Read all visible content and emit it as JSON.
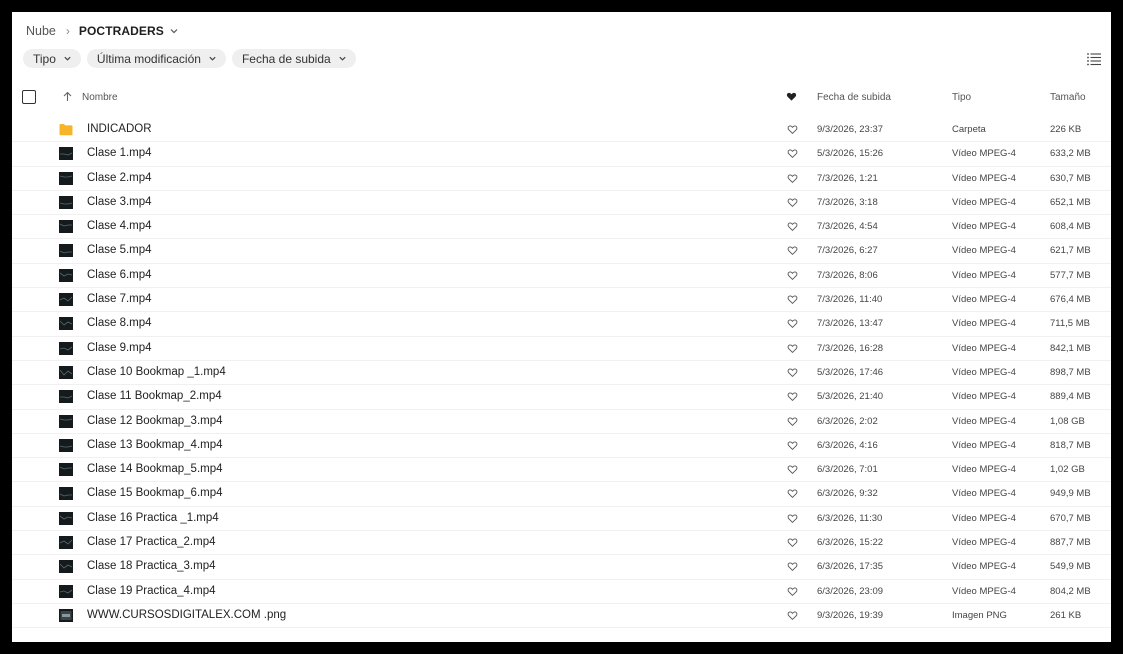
{
  "breadcrumb": {
    "root": "Nube",
    "current": "POCTRADERS"
  },
  "filters": [
    {
      "label": "Tipo"
    },
    {
      "label": "Última modificación"
    },
    {
      "label": "Fecha de subida"
    }
  ],
  "table": {
    "headers": {
      "name": "Nombre",
      "date": "Fecha de subida",
      "type": "Tipo",
      "size": "Tamaño"
    },
    "rows": [
      {
        "name": "INDICADOR",
        "date": "9/3/2026, 23:37",
        "type": "Carpeta",
        "size": "226 KB",
        "icon": "folder-icon"
      },
      {
        "name": "Clase 1.mp4",
        "date": "5/3/2026, 15:26",
        "type": "Vídeo MPEG-4",
        "size": "633,2 MB",
        "icon": "video-thumbnail-icon"
      },
      {
        "name": "Clase 2.mp4",
        "date": "7/3/2026, 1:21",
        "type": "Vídeo MPEG-4",
        "size": "630,7 MB",
        "icon": "video-thumbnail-icon"
      },
      {
        "name": "Clase 3.mp4",
        "date": "7/3/2026, 3:18",
        "type": "Vídeo MPEG-4",
        "size": "652,1 MB",
        "icon": "video-thumbnail-icon"
      },
      {
        "name": "Clase 4.mp4",
        "date": "7/3/2026, 4:54",
        "type": "Vídeo MPEG-4",
        "size": "608,4 MB",
        "icon": "video-thumbnail-icon"
      },
      {
        "name": "Clase 5.mp4",
        "date": "7/3/2026, 6:27",
        "type": "Vídeo MPEG-4",
        "size": "621,7 MB",
        "icon": "video-thumbnail-icon"
      },
      {
        "name": "Clase 6.mp4",
        "date": "7/3/2026, 8:06",
        "type": "Vídeo MPEG-4",
        "size": "577,7 MB",
        "icon": "video-thumbnail-icon"
      },
      {
        "name": "Clase 7.mp4",
        "date": "7/3/2026, 11:40",
        "type": "Vídeo MPEG-4",
        "size": "676,4 MB",
        "icon": "video-thumbnail-icon"
      },
      {
        "name": "Clase 8.mp4",
        "date": "7/3/2026, 13:47",
        "type": "Vídeo MPEG-4",
        "size": "711,5 MB",
        "icon": "video-thumbnail-icon"
      },
      {
        "name": "Clase 9.mp4",
        "date": "7/3/2026, 16:28",
        "type": "Vídeo MPEG-4",
        "size": "842,1 MB",
        "icon": "video-thumbnail-icon"
      },
      {
        "name": "Clase 10 Bookmap _1.mp4",
        "date": "5/3/2026, 17:46",
        "type": "Vídeo MPEG-4",
        "size": "898,7 MB",
        "icon": "video-thumbnail-icon"
      },
      {
        "name": "Clase 11 Bookmap_2.mp4",
        "date": "5/3/2026, 21:40",
        "type": "Vídeo MPEG-4",
        "size": "889,4 MB",
        "icon": "video-thumbnail-icon"
      },
      {
        "name": "Clase 12 Bookmap_3.mp4",
        "date": "6/3/2026, 2:02",
        "type": "Vídeo MPEG-4",
        "size": "1,08 GB",
        "icon": "video-thumbnail-icon"
      },
      {
        "name": "Clase 13 Bookmap_4.mp4",
        "date": "6/3/2026, 4:16",
        "type": "Vídeo MPEG-4",
        "size": "818,7 MB",
        "icon": "video-thumbnail-icon"
      },
      {
        "name": "Clase 14 Bookmap_5.mp4",
        "date": "6/3/2026, 7:01",
        "type": "Vídeo MPEG-4",
        "size": "1,02 GB",
        "icon": "video-thumbnail-icon"
      },
      {
        "name": "Clase 15 Bookmap_6.mp4",
        "date": "6/3/2026, 9:32",
        "type": "Vídeo MPEG-4",
        "size": "949,9 MB",
        "icon": "video-thumbnail-icon"
      },
      {
        "name": "Clase 16 Practica _1.mp4",
        "date": "6/3/2026, 11:30",
        "type": "Vídeo MPEG-4",
        "size": "670,7 MB",
        "icon": "video-thumbnail-icon"
      },
      {
        "name": "Clase 17 Practica_2.mp4",
        "date": "6/3/2026, 15:22",
        "type": "Vídeo MPEG-4",
        "size": "887,7 MB",
        "icon": "video-thumbnail-icon"
      },
      {
        "name": "Clase 18 Practica_3.mp4",
        "date": "6/3/2026, 17:35",
        "type": "Vídeo MPEG-4",
        "size": "549,9 MB",
        "icon": "video-thumbnail-icon"
      },
      {
        "name": "Clase 19 Practica_4.mp4",
        "date": "6/3/2026, 23:09",
        "type": "Vídeo MPEG-4",
        "size": "804,2 MB",
        "icon": "video-thumbnail-icon"
      },
      {
        "name": "WWW.CURSOSDIGITALEX.COM .png",
        "date": "9/3/2026, 19:39",
        "type": "Imagen PNG",
        "size": "261 KB",
        "icon": "image-thumbnail-icon"
      }
    ]
  },
  "colors": {
    "folder": "#f5b42a",
    "thumbnail": "#151a1d",
    "chip_bg": "#efefef",
    "window_bg": "#ffffff",
    "frame_bg": "#000000"
  }
}
